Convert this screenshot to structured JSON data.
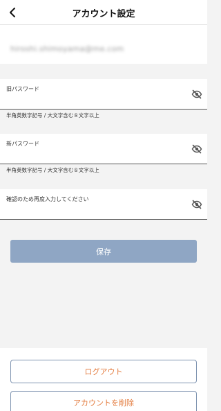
{
  "header": {
    "title": "アカウント設定"
  },
  "account": {
    "email": "hiroshi.shimoyama@me.com"
  },
  "fields": [
    {
      "label": "旧パスワード",
      "hint": "半角英数字記号 / 大文字含む８文字以上"
    },
    {
      "label": "新パスワード",
      "hint": "半角英数字記号 / 大文字含む８文字以上"
    },
    {
      "label": "確認のため再度入力してください"
    }
  ],
  "actions": {
    "save_label": "保存",
    "logout_label": "ログアウト",
    "delete_label": "アカウントを削除"
  },
  "colors": {
    "save_button": "#8fa6c4",
    "danger_text": "#e37a3c",
    "button_border": "#7e93b0"
  },
  "icons": {
    "back": "chevron-left-icon",
    "visibility": "eye-off-icon"
  }
}
